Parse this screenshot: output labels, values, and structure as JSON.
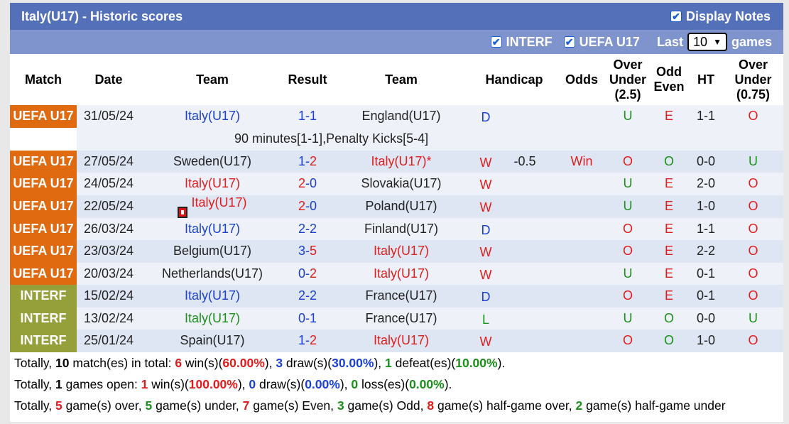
{
  "title": "Italy(U17) - Historic scores",
  "display_notes_label": "Display Notes",
  "filters": {
    "interf_label": "INTERF",
    "uefa_label": "UEFA U17",
    "last_label": "Last",
    "last_value": "10",
    "games_label": "games"
  },
  "headers": {
    "match": "Match",
    "date": "Date",
    "team1": "Team",
    "result": "Result",
    "team2": "Team",
    "handicap": "Handicap",
    "odds": "Odds",
    "ou1": "Over",
    "ou2": "Under",
    "ou3": "(2.5)",
    "oe1": "Odd",
    "oe2": "Even",
    "ht": "HT",
    "ou075_1": "Over",
    "ou075_2": "Under",
    "ou075_3": "(0.75)"
  },
  "rows": [
    {
      "comp": "UEFA U17",
      "date": "31/05/24",
      "home": "Italy(U17)",
      "home_color": "blue",
      "score_h": "1",
      "score_a": "1",
      "score_color_h": "blue",
      "score_color_a": "blue",
      "away": "England(U17)",
      "away_color": "black",
      "wl": "D",
      "wl_color": "blue",
      "handicap": "",
      "odds": "",
      "ou": "U",
      "ou_color": "green",
      "oe": "E",
      "oe_color": "red",
      "ht": "1-1",
      "ou075": "O",
      "ou075_color": "red",
      "note": "90 minutes[1-1],Penalty Kicks[5-4]"
    },
    {
      "comp": "UEFA U17",
      "date": "27/05/24",
      "home": "Sweden(U17)",
      "home_color": "black",
      "score_h": "1",
      "score_a": "2",
      "score_color_h": "blue",
      "score_color_a": "red",
      "away": "Italy(U17)*",
      "away_color": "red",
      "wl": "W",
      "wl_color": "red",
      "handicap": "-0.5",
      "odds": "Win",
      "ou": "O",
      "ou_color": "red",
      "oe": "O",
      "oe_color": "green",
      "ht": "0-0",
      "ou075": "U",
      "ou075_color": "green"
    },
    {
      "comp": "UEFA U17",
      "date": "24/05/24",
      "home": "Italy(U17)",
      "home_color": "red",
      "score_h": "2",
      "score_a": "0",
      "score_color_h": "red",
      "score_color_a": "blue",
      "away": "Slovakia(U17)",
      "away_color": "black",
      "wl": "W",
      "wl_color": "red",
      "handicap": "",
      "odds": "",
      "ou": "U",
      "ou_color": "green",
      "oe": "E",
      "oe_color": "red",
      "ht": "2-0",
      "ou075": "O",
      "ou075_color": "red"
    },
    {
      "comp": "UEFA U17",
      "date": "22/05/24",
      "home": "Italy(U17)",
      "home_color": "red",
      "home_card": "1",
      "score_h": "2",
      "score_a": "0",
      "score_color_h": "red",
      "score_color_a": "blue",
      "away": "Poland(U17)",
      "away_color": "black",
      "wl": "W",
      "wl_color": "red",
      "handicap": "",
      "odds": "",
      "ou": "U",
      "ou_color": "green",
      "oe": "E",
      "oe_color": "red",
      "ht": "1-0",
      "ou075": "O",
      "ou075_color": "red"
    },
    {
      "comp": "UEFA U17",
      "date": "26/03/24",
      "home": "Italy(U17)",
      "home_color": "blue",
      "score_h": "2",
      "score_a": "2",
      "score_color_h": "blue",
      "score_color_a": "blue",
      "away": "Finland(U17)",
      "away_color": "black",
      "wl": "D",
      "wl_color": "blue",
      "handicap": "",
      "odds": "",
      "ou": "O",
      "ou_color": "red",
      "oe": "E",
      "oe_color": "red",
      "ht": "1-1",
      "ou075": "O",
      "ou075_color": "red"
    },
    {
      "comp": "UEFA U17",
      "date": "23/03/24",
      "home": "Belgium(U17)",
      "home_color": "black",
      "score_h": "3",
      "score_a": "5",
      "score_color_h": "blue",
      "score_color_a": "red",
      "away": "Italy(U17)",
      "away_color": "red",
      "wl": "W",
      "wl_color": "red",
      "handicap": "",
      "odds": "",
      "ou": "O",
      "ou_color": "red",
      "oe": "E",
      "oe_color": "red",
      "ht": "2-2",
      "ou075": "O",
      "ou075_color": "red"
    },
    {
      "comp": "UEFA U17",
      "date": "20/03/24",
      "home": "Netherlands(U17)",
      "home_color": "black",
      "score_h": "0",
      "score_a": "2",
      "score_color_h": "blue",
      "score_color_a": "red",
      "away": "Italy(U17)",
      "away_color": "red",
      "wl": "W",
      "wl_color": "red",
      "handicap": "",
      "odds": "",
      "ou": "U",
      "ou_color": "green",
      "oe": "E",
      "oe_color": "red",
      "ht": "0-1",
      "ou075": "O",
      "ou075_color": "red"
    },
    {
      "comp": "INTERF",
      "date": "15/02/24",
      "home": "Italy(U17)",
      "home_color": "blue",
      "score_h": "2",
      "score_a": "2",
      "score_color_h": "blue",
      "score_color_a": "blue",
      "away": "France(U17)",
      "away_color": "black",
      "wl": "D",
      "wl_color": "blue",
      "handicap": "",
      "odds": "",
      "ou": "O",
      "ou_color": "red",
      "oe": "E",
      "oe_color": "red",
      "ht": "0-1",
      "ou075": "O",
      "ou075_color": "red"
    },
    {
      "comp": "INTERF",
      "date": "13/02/24",
      "home": "Italy(U17)",
      "home_color": "green",
      "score_h": "0",
      "score_a": "1",
      "score_color_h": "blue",
      "score_color_a": "blue",
      "away": "France(U17)",
      "away_color": "black",
      "wl": "L",
      "wl_color": "green",
      "handicap": "",
      "odds": "",
      "ou": "U",
      "ou_color": "green",
      "oe": "O",
      "oe_color": "green",
      "ht": "0-0",
      "ou075": "U",
      "ou075_color": "green"
    },
    {
      "comp": "INTERF",
      "date": "25/01/24",
      "home": "Spain(U17)",
      "home_color": "black",
      "score_h": "1",
      "score_a": "2",
      "score_color_h": "blue",
      "score_color_a": "red",
      "away": "Italy(U17)",
      "away_color": "red",
      "wl": "W",
      "wl_color": "red",
      "handicap": "",
      "odds": "",
      "ou": "O",
      "ou_color": "red",
      "oe": "O",
      "oe_color": "green",
      "ht": "1-0",
      "ou075": "O",
      "ou075_color": "red"
    }
  ],
  "summary": {
    "line1": [
      "Totally, ",
      "10",
      " match(es) in total: ",
      "6",
      " win(s)(",
      "60.00%",
      "), ",
      "3",
      " draw(s)(",
      "30.00%",
      "), ",
      "1",
      " defeat(es)(",
      "10.00%",
      ")."
    ],
    "line2": [
      "Totally, ",
      "1",
      " games open: ",
      "1",
      " win(s)(",
      "100.00%",
      "), ",
      "0",
      " draw(s)(",
      "0.00%",
      "), ",
      "0",
      " loss(es)(",
      "0.00%",
      ")."
    ],
    "line3": [
      "Totally, ",
      "5",
      " game(s) over, ",
      "5",
      " game(s) under, ",
      "7",
      " game(s) Even, ",
      "3",
      " game(s) Odd, ",
      "8",
      " game(s) half-game over, ",
      "2",
      " game(s) half-game under"
    ]
  },
  "colors": {
    "title_bg": "#5470b8",
    "filter_bg": "#7f93cd",
    "uefa": "#e06a10",
    "interf": "#95a03a",
    "win_red": "#e01c1c",
    "draw_blue": "#1b3fd0",
    "loss_green": "#1a8f1a"
  }
}
